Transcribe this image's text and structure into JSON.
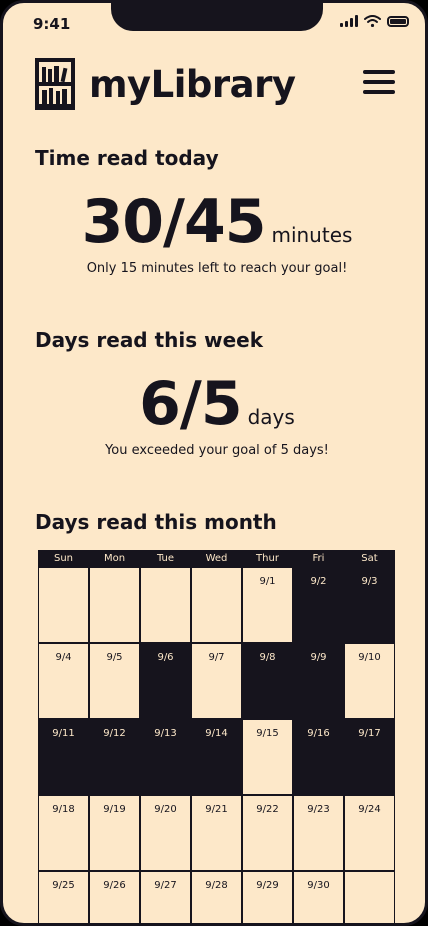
{
  "status_bar": {
    "time": "9:41"
  },
  "app": {
    "title": "myLibrary",
    "logo_icon": "bookshelf-icon",
    "menu_icon": "hamburger-menu-icon"
  },
  "today": {
    "title": "Time read today",
    "value": "30/45",
    "unit": "minutes",
    "message": "Only 15 minutes left to reach your goal!"
  },
  "week": {
    "title": "Days read this week",
    "value": "6/5",
    "unit": "days",
    "message": "You exceeded your goal of 5 days!"
  },
  "month": {
    "title": "Days read this month",
    "weekdays": [
      "Sun",
      "Mon",
      "Tue",
      "Wed",
      "Thur",
      "Fri",
      "Sat"
    ],
    "cells": [
      {
        "label": "",
        "read": false
      },
      {
        "label": "",
        "read": false
      },
      {
        "label": "",
        "read": false
      },
      {
        "label": "",
        "read": false
      },
      {
        "label": "9/1",
        "read": false
      },
      {
        "label": "9/2",
        "read": true
      },
      {
        "label": "9/3",
        "read": true
      },
      {
        "label": "9/4",
        "read": false
      },
      {
        "label": "9/5",
        "read": false
      },
      {
        "label": "9/6",
        "read": true
      },
      {
        "label": "9/7",
        "read": false
      },
      {
        "label": "9/8",
        "read": true
      },
      {
        "label": "9/9",
        "read": true
      },
      {
        "label": "9/10",
        "read": false
      },
      {
        "label": "9/11",
        "read": true
      },
      {
        "label": "9/12",
        "read": true
      },
      {
        "label": "9/13",
        "read": true
      },
      {
        "label": "9/14",
        "read": true
      },
      {
        "label": "9/15",
        "read": false
      },
      {
        "label": "9/16",
        "read": true
      },
      {
        "label": "9/17",
        "read": true
      },
      {
        "label": "9/18",
        "read": false
      },
      {
        "label": "9/19",
        "read": false
      },
      {
        "label": "9/20",
        "read": false
      },
      {
        "label": "9/21",
        "read": false
      },
      {
        "label": "9/22",
        "read": false
      },
      {
        "label": "9/23",
        "read": false
      },
      {
        "label": "9/24",
        "read": false
      },
      {
        "label": "9/25",
        "read": false
      },
      {
        "label": "9/26",
        "read": false
      },
      {
        "label": "9/27",
        "read": false
      },
      {
        "label": "9/28",
        "read": false
      },
      {
        "label": "9/29",
        "read": false
      },
      {
        "label": "9/30",
        "read": false
      },
      {
        "label": "",
        "read": false
      }
    ]
  },
  "colors": {
    "background": "#fde8c9",
    "ink": "#16141d"
  }
}
